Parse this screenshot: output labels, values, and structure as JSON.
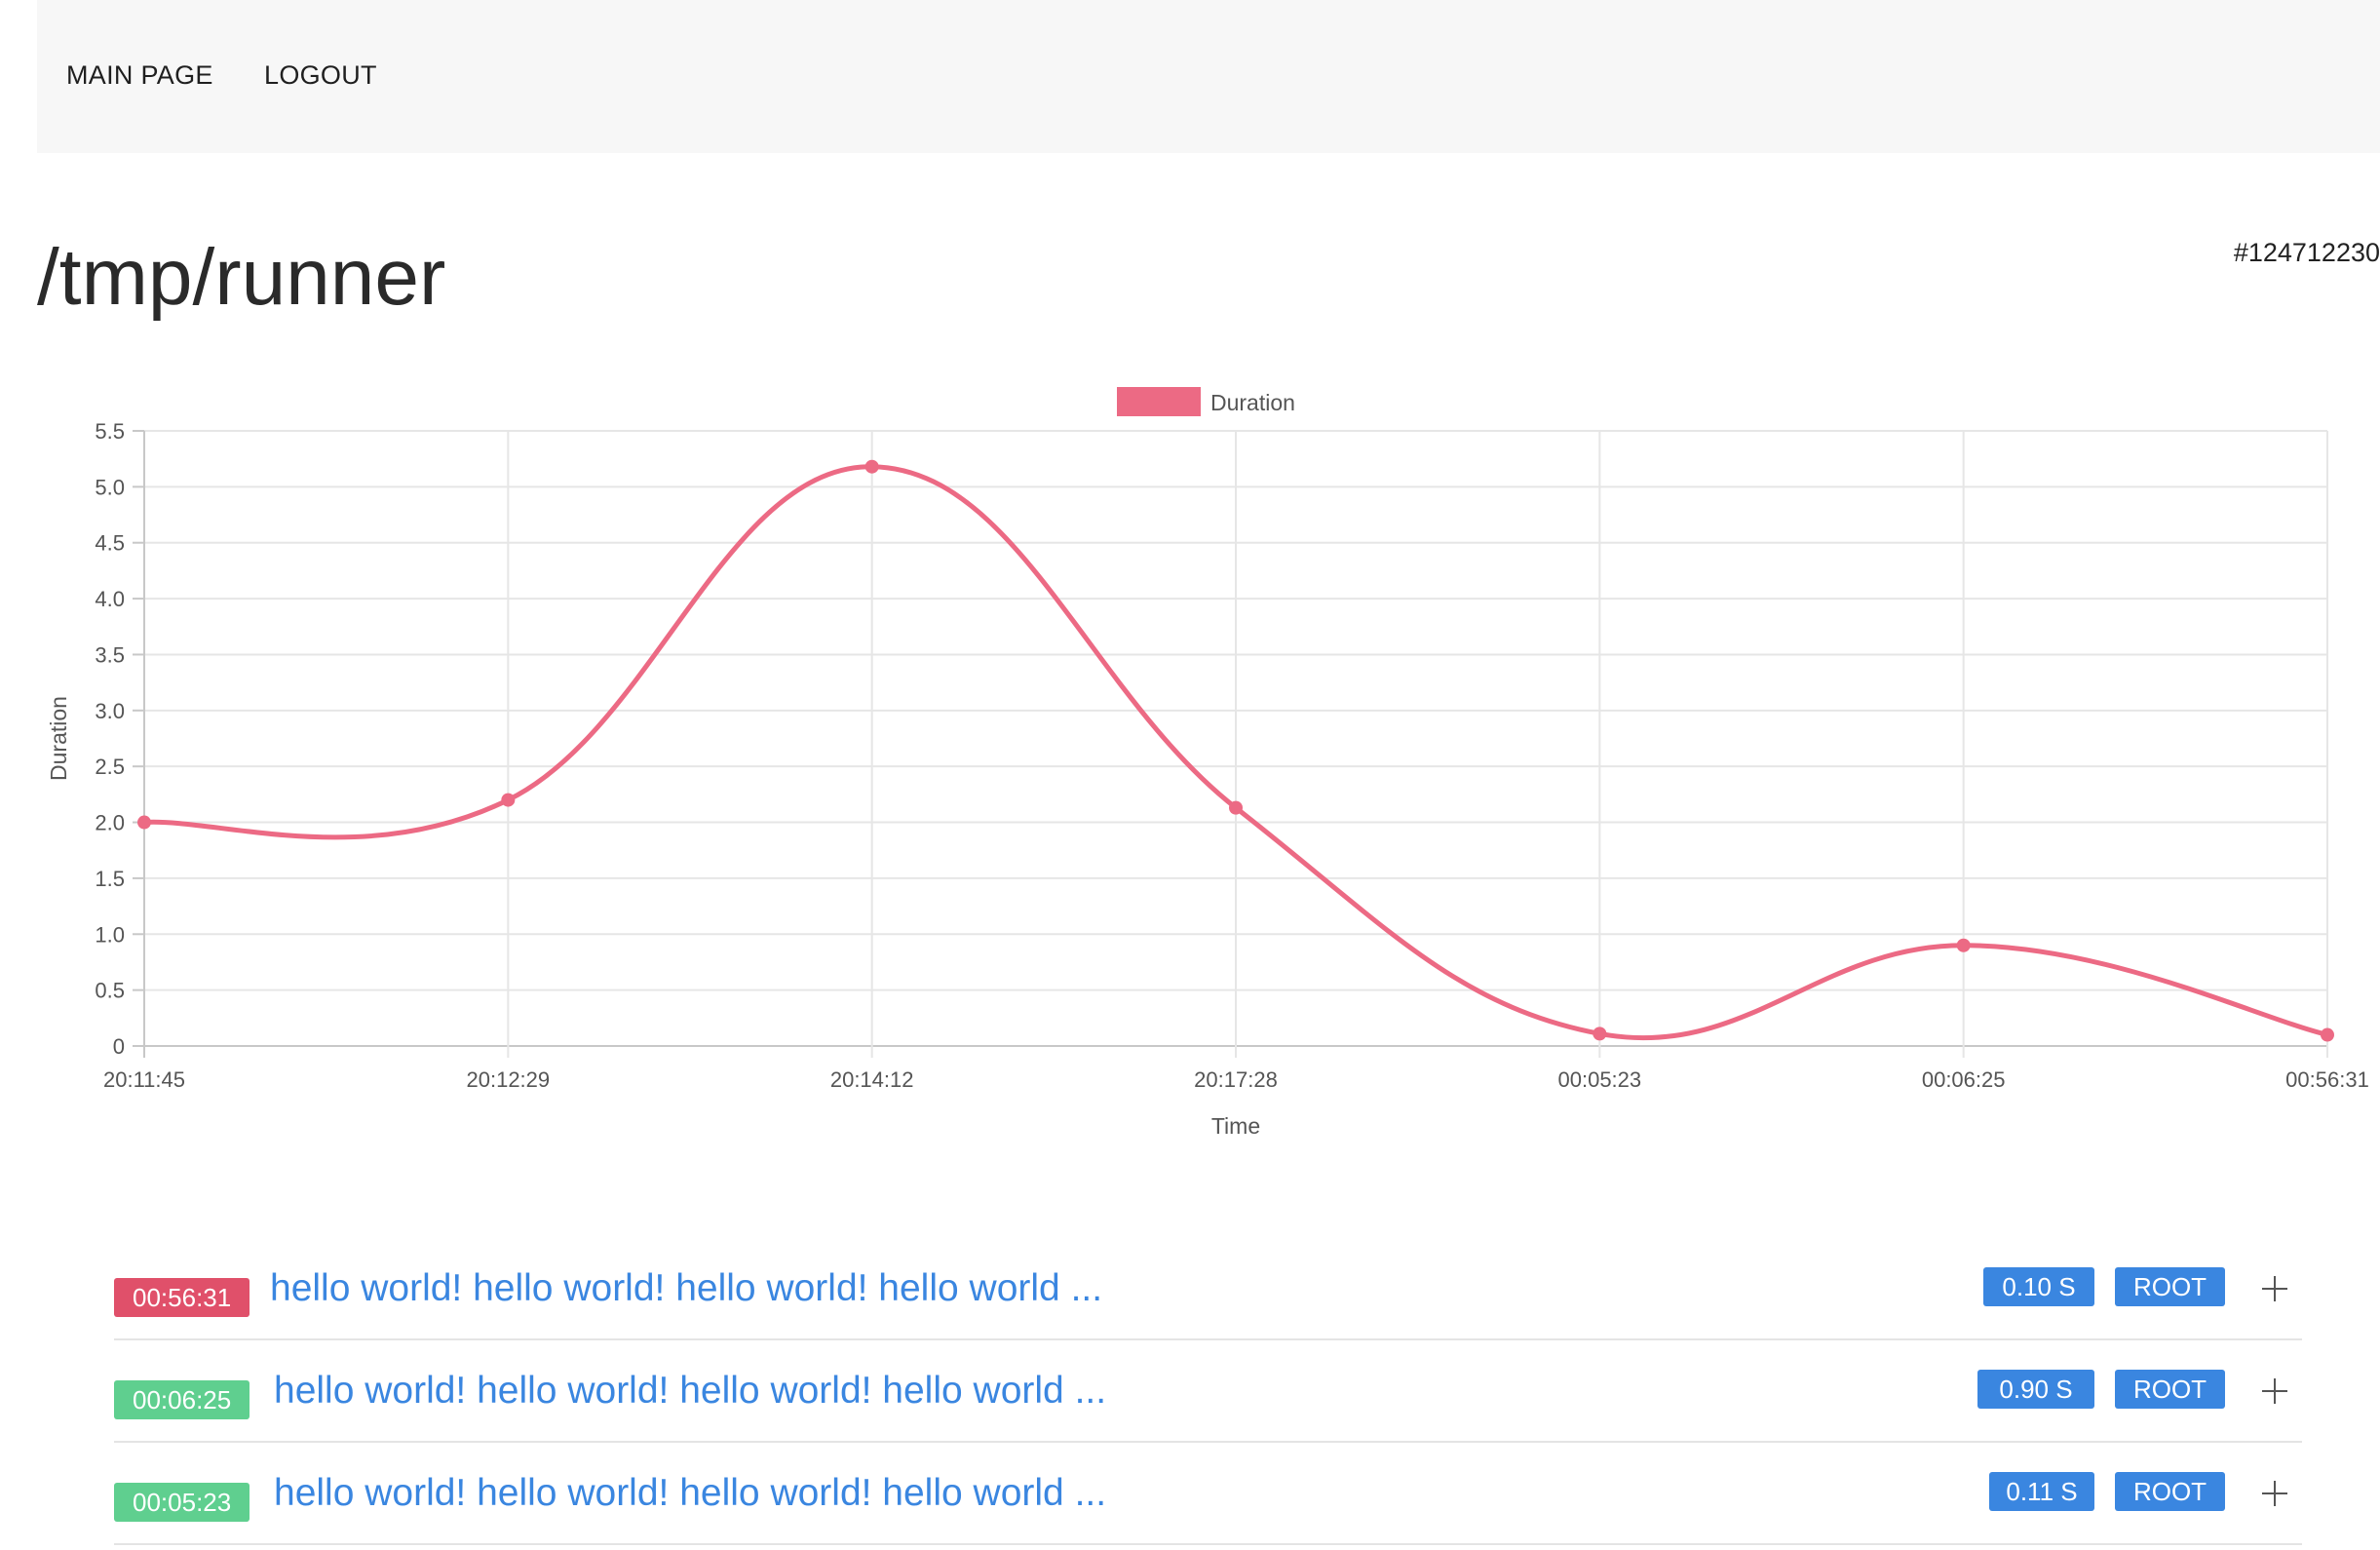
{
  "nav": {
    "items": [
      {
        "label": "MAIN PAGE"
      },
      {
        "label": "LOGOUT"
      }
    ]
  },
  "page": {
    "title": "/tmp/runner",
    "run_id": "#124712230"
  },
  "colors": {
    "accent_blue": "#3a86e0",
    "series_red": "#ec6a84",
    "badge_red": "#e0506a",
    "badge_green": "#5fcf8f",
    "navbar_bg": "#f7f7f7"
  },
  "chart_data": {
    "type": "line",
    "title": "",
    "xlabel": "Time",
    "ylabel": "Duration",
    "x": [
      "20:11:45",
      "20:12:29",
      "20:14:12",
      "20:17:28",
      "00:05:23",
      "00:06:25",
      "00:56:31"
    ],
    "series": [
      {
        "name": "Duration",
        "values": [
          2.0,
          2.2,
          5.18,
          2.13,
          0.11,
          0.9,
          0.1
        ],
        "color": "#ec6a84"
      }
    ],
    "ylim": [
      0,
      5.5
    ],
    "yticks": [
      "0",
      "0.5",
      "1.0",
      "1.5",
      "2.0",
      "2.5",
      "3.0",
      "3.5",
      "4.0",
      "4.5",
      "5.0",
      "5.5"
    ],
    "grid": true,
    "smooth": true,
    "legend": "top-center"
  },
  "runs": [
    {
      "time": "00:56:31",
      "status": "failed",
      "status_color": "#e0506a",
      "message": "hello world! hello world! hello world! hello world ...",
      "duration": "0.10 S",
      "user": "ROOT"
    },
    {
      "time": "00:06:25",
      "status": "success",
      "status_color": "#5fcf8f",
      "message": "hello world! hello world! hello world! hello world ...",
      "duration": "0.90 S",
      "user": "ROOT"
    },
    {
      "time": "00:05:23",
      "status": "success",
      "status_color": "#5fcf8f",
      "message": "hello world! hello world! hello world! hello world ...",
      "duration": "0.11 S",
      "user": "ROOT"
    }
  ]
}
